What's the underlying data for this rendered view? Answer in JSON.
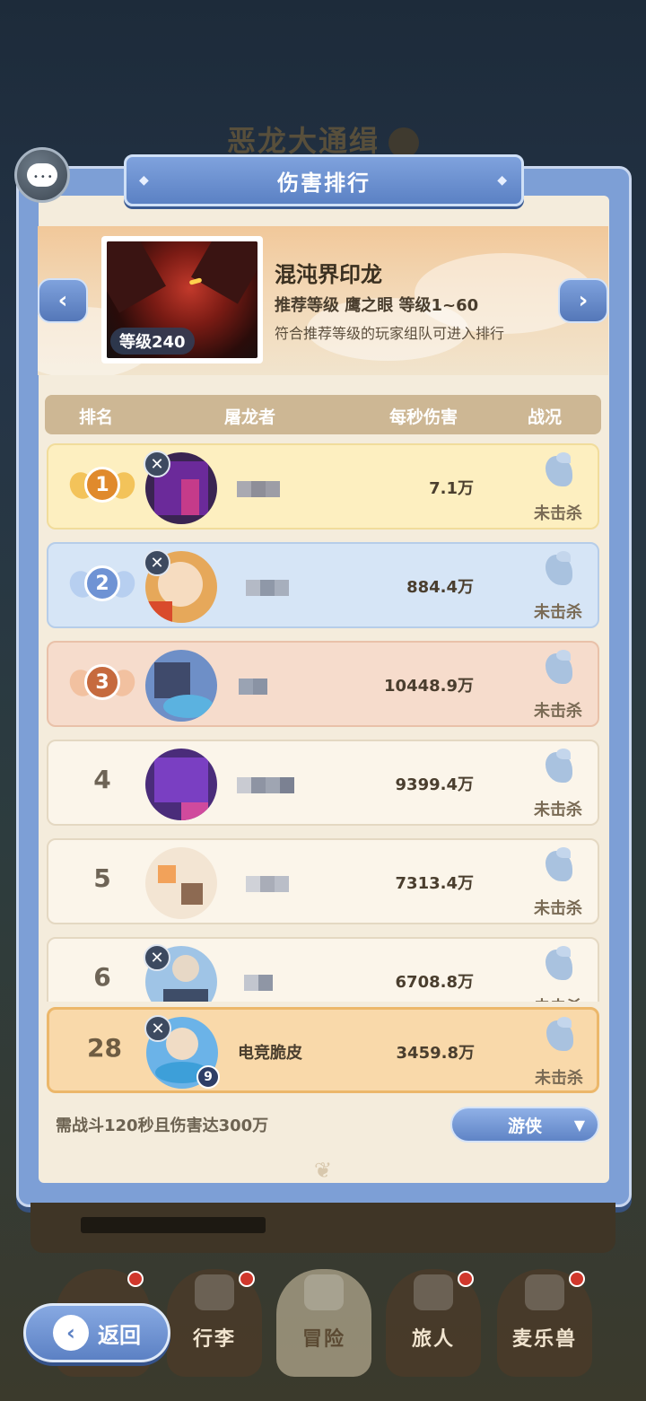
{
  "background": {
    "title": "恶龙大通缉"
  },
  "panel": {
    "title": "伤害排行"
  },
  "boss": {
    "name": "混沌界印龙",
    "level_label": "等级240",
    "recommend": "推荐等级  鹰之眼  等级1~60",
    "note": "符合推荐等级的玩家组队可进入排行",
    "prev_icon": "chevron-left-icon",
    "next_icon": "chevron-right-icon"
  },
  "table": {
    "headers": {
      "rank": "排名",
      "player": "屠龙者",
      "dps": "每秒伤害",
      "status": "战况"
    },
    "rows": [
      {
        "rank": "1",
        "name": "",
        "dps": "7.1万",
        "status": "未击杀"
      },
      {
        "rank": "2",
        "name": "",
        "dps": "884.4万",
        "status": "未击杀"
      },
      {
        "rank": "3",
        "name": "",
        "dps": "10448.9万",
        "status": "未击杀"
      },
      {
        "rank": "4",
        "name": "",
        "dps": "9399.4万",
        "status": "未击杀"
      },
      {
        "rank": "5",
        "name": "",
        "dps": "7313.4万",
        "status": "未击杀"
      },
      {
        "rank": "6",
        "name": "",
        "dps": "6708.8万",
        "status": "未击杀"
      }
    ],
    "self": {
      "rank": "28",
      "name": "电竞脆皮",
      "dps": "3459.8万",
      "status": "未击杀",
      "level": "9"
    }
  },
  "footer": {
    "requirement": "需战斗120秒且伤害达300万",
    "class_select": "游侠"
  },
  "bottom_nav": {
    "back": "返回",
    "items": [
      "行李",
      "冒险",
      "旅人",
      "麦乐兽"
    ]
  },
  "colors": {
    "panel_blue": "#7d9fd6",
    "parchment": "#f4ecdc",
    "gold_row": "#fdefc0",
    "silver_row": "#d6e5f6",
    "bronze_row": "#f6dccc",
    "self_row": "#f9d9aa"
  }
}
